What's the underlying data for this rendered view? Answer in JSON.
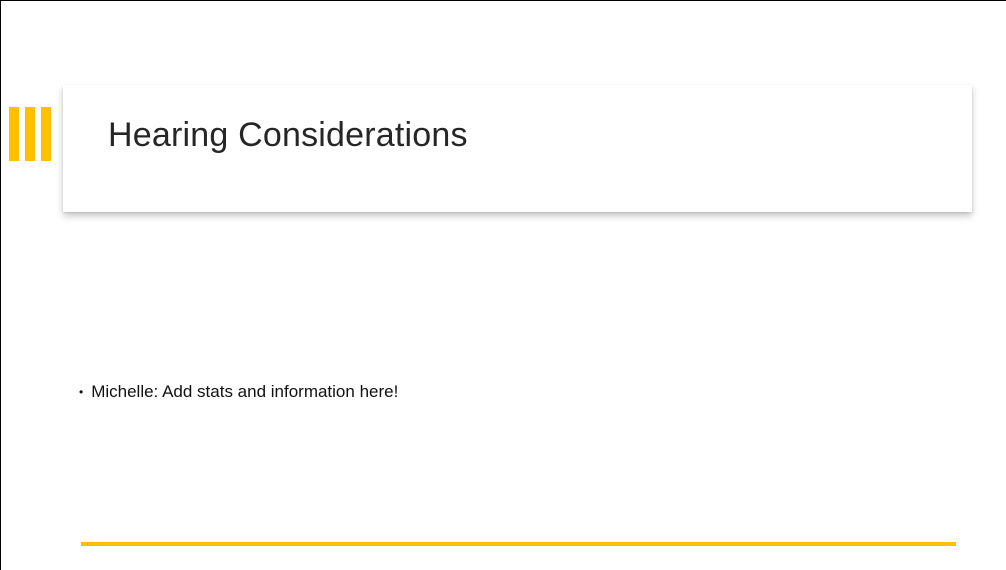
{
  "slide": {
    "title": "Hearing Considerations",
    "bullets": [
      {
        "text": "Michelle: Add stats and information here!"
      }
    ],
    "bullet_glyph": "•"
  },
  "colors": {
    "accent": "#FFC000",
    "accent_light": "#FFD24D",
    "title_text": "#262626",
    "body_text": "#111111"
  }
}
